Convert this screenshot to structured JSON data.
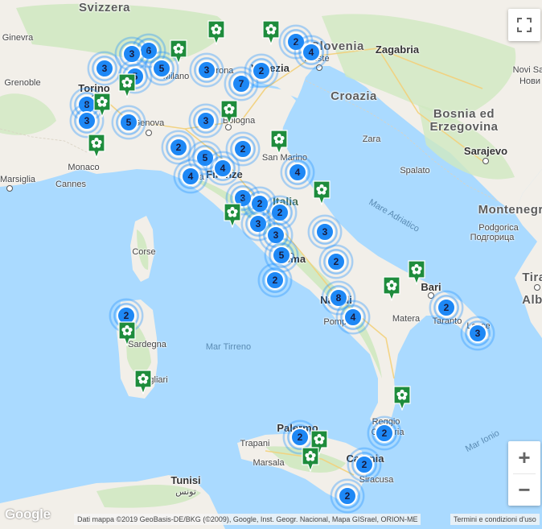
{
  "labels": {
    "countries": [
      {
        "name": "Svizzera",
        "k": "ch"
      },
      {
        "name": "Slovenia",
        "k": "si"
      },
      {
        "name": "Croazia",
        "k": "hr"
      },
      {
        "name": "Bosnia ed",
        "k": "ba1"
      },
      {
        "name": "Erzegovina",
        "k": "ba2"
      },
      {
        "name": "Montenegro",
        "k": "me"
      },
      {
        "name": "Tira",
        "k": "al1"
      },
      {
        "name": "Alb",
        "k": "al2"
      }
    ],
    "regions": [
      {
        "name": "Italia",
        "k": "it"
      }
    ],
    "cities": [
      {
        "name": "Zagabria",
        "k": "zg",
        "bold": true
      },
      {
        "name": "Sarajevo",
        "k": "sa",
        "bold": true
      },
      {
        "name": "Tunisi",
        "k": "tn",
        "bold": true
      },
      {
        "name": "Torino",
        "k": "to",
        "bold": true
      },
      {
        "name": "Genova",
        "k": "ge"
      },
      {
        "name": "Firenze",
        "k": "fi",
        "bold": true
      },
      {
        "name": "Roma",
        "k": "rm",
        "bold": true
      },
      {
        "name": "Napoli",
        "k": "na",
        "bold": true
      },
      {
        "name": "Bari",
        "k": "ba",
        "bold": true
      },
      {
        "name": "Palermo",
        "k": "pa",
        "bold": true
      },
      {
        "name": "Catania",
        "k": "ct",
        "bold": true
      },
      {
        "name": "Venezia",
        "k": "ve",
        "bold": true
      },
      {
        "name": "Trieste",
        "k": "ts"
      },
      {
        "name": "Milano",
        "k": "mi"
      },
      {
        "name": "Bologna",
        "k": "bo"
      },
      {
        "name": "Verona",
        "k": "vr"
      },
      {
        "name": "San Marino",
        "k": "sm"
      },
      {
        "name": "Pisa",
        "k": "pi"
      },
      {
        "name": "Monaco",
        "k": "mc"
      },
      {
        "name": "Cannes",
        "k": "cn"
      },
      {
        "name": "Grenoble",
        "k": "gr"
      },
      {
        "name": "Ginevra",
        "k": "gv"
      },
      {
        "name": "Marsiglia",
        "k": "mr"
      },
      {
        "name": "Corse",
        "k": "co"
      },
      {
        "name": "Sardegna",
        "k": "sd"
      },
      {
        "name": "Cagliari",
        "k": "ca"
      },
      {
        "name": "Trapani",
        "k": "tp"
      },
      {
        "name": "Marsala",
        "k": "ms"
      },
      {
        "name": "Siracusa",
        "k": "sr"
      },
      {
        "name": "Reggio",
        "k": "rc1"
      },
      {
        "name": "Calabria",
        "k": "rc2"
      },
      {
        "name": "Matera",
        "k": "mt"
      },
      {
        "name": "Taranto",
        "k": "ta"
      },
      {
        "name": "Lecce",
        "k": "le"
      },
      {
        "name": "Pompei",
        "k": "po"
      },
      {
        "name": "Zara",
        "k": "za"
      },
      {
        "name": "Spalato",
        "k": "sp"
      },
      {
        "name": "Podgorica",
        "k": "pg1"
      },
      {
        "name": "Подгорица",
        "k": "pg2"
      },
      {
        "name": "Novi Sad",
        "k": "ns1"
      },
      {
        "name": "Нови",
        "k": "ns2"
      }
    ],
    "seas": [
      {
        "name": "Mare Adriatico",
        "k": "adr"
      },
      {
        "name": "Mar Tirreno",
        "k": "tir"
      },
      {
        "name": "Mar Ionio",
        "k": "ion"
      }
    ],
    "arabic": "تونس"
  },
  "clusters": [
    {
      "n": "3",
      "k": "c1"
    },
    {
      "n": "6",
      "k": "c2"
    },
    {
      "n": "3",
      "k": "c3"
    },
    {
      "n": "5",
      "k": "c4"
    },
    {
      "n": "5",
      "k": "c5"
    },
    {
      "n": "3",
      "k": "c6"
    },
    {
      "n": "8",
      "k": "c7"
    },
    {
      "n": "3",
      "k": "c8"
    },
    {
      "n": "5",
      "k": "c9"
    },
    {
      "n": "3",
      "k": "c10"
    },
    {
      "n": "7",
      "k": "c11"
    },
    {
      "n": "2",
      "k": "c12"
    },
    {
      "n": "2",
      "k": "c13"
    },
    {
      "n": "4",
      "k": "c14"
    },
    {
      "n": "2",
      "k": "c15"
    },
    {
      "n": "5",
      "k": "c16"
    },
    {
      "n": "2",
      "k": "c17"
    },
    {
      "n": "4",
      "k": "c18"
    },
    {
      "n": "4",
      "k": "c19"
    },
    {
      "n": "4",
      "k": "c20"
    },
    {
      "n": "3",
      "k": "c21"
    },
    {
      "n": "2",
      "k": "c22"
    },
    {
      "n": "2",
      "k": "c23"
    },
    {
      "n": "3",
      "k": "c24"
    },
    {
      "n": "3",
      "k": "c25"
    },
    {
      "n": "3",
      "k": "c26"
    },
    {
      "n": "5",
      "k": "c27"
    },
    {
      "n": "2",
      "k": "c28"
    },
    {
      "n": "2",
      "k": "c29"
    },
    {
      "n": "8",
      "k": "c30"
    },
    {
      "n": "4",
      "k": "c31"
    },
    {
      "n": "2",
      "k": "c32"
    },
    {
      "n": "3",
      "k": "c33"
    },
    {
      "n": "2",
      "k": "c34"
    },
    {
      "n": "2",
      "k": "c35"
    },
    {
      "n": "2",
      "k": "c36"
    },
    {
      "n": "2",
      "k": "c37"
    },
    {
      "n": "2",
      "k": "c38"
    }
  ],
  "marker_count": 16,
  "controls": {
    "zoom_in": "+",
    "zoom_out": "−"
  },
  "footer": {
    "logo": "Google",
    "attribution": "Dati mappa ©2019 GeoBasis-DE/BKG (©2009), Google, Inst. Geogr. Nacional, Mapa GISrael, ORION-ME",
    "terms": "Termini e condizioni d'uso"
  },
  "colors": {
    "water": "#aadaff",
    "land": "#f2efe9",
    "green": "#cfe8c0",
    "cluster": "#1e88f5",
    "marker": "#1e8c3c"
  }
}
